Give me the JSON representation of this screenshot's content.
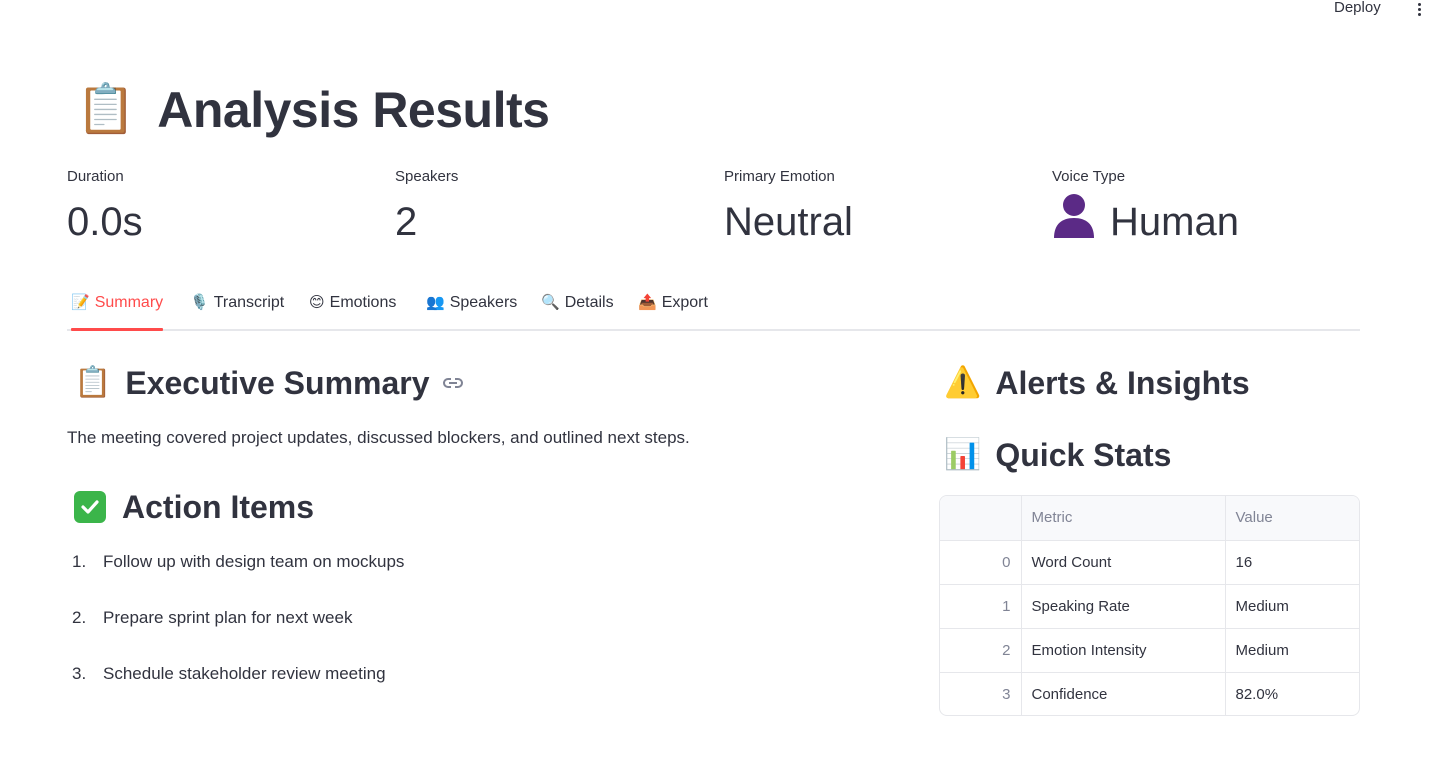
{
  "header": {
    "deploy_label": "Deploy"
  },
  "page": {
    "title": "Analysis Results",
    "title_icon": "clipboard-icon"
  },
  "metrics": [
    {
      "label": "Duration",
      "value": "0.0s"
    },
    {
      "label": "Speakers",
      "value": "2"
    },
    {
      "label": "Primary Emotion",
      "value": "Neutral"
    },
    {
      "label": "Voice Type",
      "value": "Human",
      "icon": "person-silhouette-icon"
    }
  ],
  "tabs": [
    {
      "label": "Summary",
      "icon": "memo-icon",
      "active": true
    },
    {
      "label": "Transcript",
      "icon": "microphone-icon",
      "active": false
    },
    {
      "label": "Emotions",
      "icon": "smiling-face-icon",
      "active": false
    },
    {
      "label": "Speakers",
      "icon": "people-icon",
      "active": false
    },
    {
      "label": "Details",
      "icon": "magnifier-icon",
      "active": false
    },
    {
      "label": "Export",
      "icon": "outbox-tray-icon",
      "active": false
    }
  ],
  "executive_summary": {
    "heading": "Executive Summary",
    "text": "The meeting covered project updates, discussed blockers, and outlined next steps."
  },
  "action_items": {
    "heading": "Action Items",
    "items": [
      {
        "num": "1.",
        "text": "Follow up with design team on mockups"
      },
      {
        "num": "2.",
        "text": "Prepare sprint plan for next week"
      },
      {
        "num": "3.",
        "text": "Schedule stakeholder review meeting"
      }
    ]
  },
  "alerts": {
    "heading": "Alerts & Insights"
  },
  "quick_stats": {
    "heading": "Quick Stats",
    "columns": [
      "",
      "Metric",
      "Value"
    ],
    "rows": [
      {
        "index": "0",
        "metric": "Word Count",
        "value": "16"
      },
      {
        "index": "1",
        "metric": "Speaking Rate",
        "value": "Medium"
      },
      {
        "index": "2",
        "metric": "Emotion Intensity",
        "value": "Medium"
      },
      {
        "index": "3",
        "metric": "Confidence",
        "value": "82.0%"
      }
    ]
  },
  "colors": {
    "accent": "#ff4b4b",
    "text": "#31333f",
    "muted": "#808495",
    "border": "#e6e7eb",
    "check_green": "#3bb54a"
  }
}
